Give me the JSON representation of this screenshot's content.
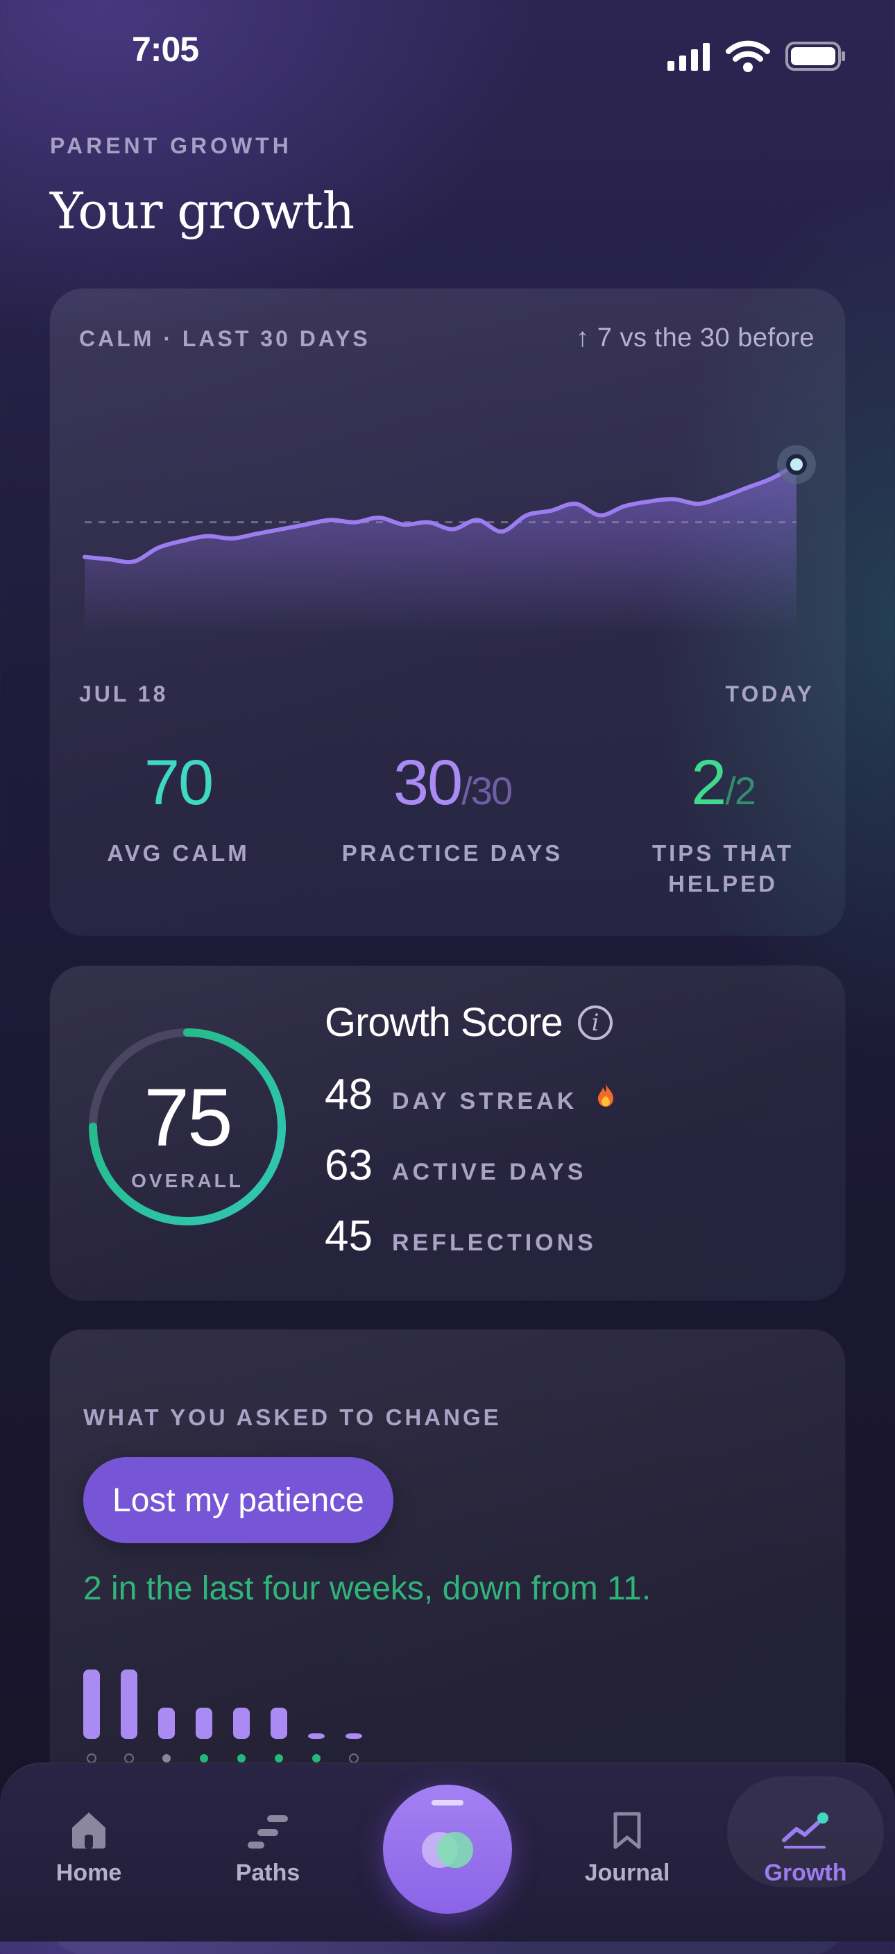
{
  "status_bar": {
    "time": "7:05"
  },
  "header": {
    "eyebrow": "PARENT GROWTH",
    "title": "Your growth"
  },
  "calm_card": {
    "label": "CALM · LAST 30 DAYS",
    "trend": "↑ 7 vs the 30 before",
    "start_label": "JUL 18",
    "end_label": "TODAY",
    "line_color": "#9b7df0",
    "stats": [
      {
        "value": "70",
        "denominator": "",
        "label": "AVG CALM",
        "color": "#3fd8c0"
      },
      {
        "value": "30",
        "denominator": "/30",
        "label": "PRACTICE DAYS",
        "color": "#a98bf3"
      },
      {
        "value": "2",
        "denominator": "/2",
        "label": "TIPS THAT HELPED",
        "color": "#3fd98f"
      }
    ]
  },
  "chart_data": {
    "type": "area",
    "title": "CALM · LAST 30 DAYS",
    "x": [
      "JUL 18",
      "",
      "",
      "",
      "",
      "",
      "",
      "",
      "",
      "",
      "",
      "",
      "",
      "",
      "",
      "",
      "",
      "",
      "",
      "",
      "",
      "",
      "",
      "",
      "",
      "",
      "",
      "",
      "",
      "TODAY"
    ],
    "values": [
      48,
      47,
      46,
      52,
      55,
      57,
      56,
      58,
      60,
      62,
      64,
      63,
      65,
      62,
      63,
      60,
      64,
      59,
      66,
      68,
      71,
      66,
      70,
      72,
      73,
      71,
      74,
      78,
      82,
      88
    ],
    "reference_value": 63,
    "xlabel": "",
    "ylabel": "",
    "grid": false
  },
  "growth_score": {
    "title": "Growth Score",
    "overall_value": "75",
    "overall_label": "OVERALL",
    "progress": 0.75,
    "rows": [
      {
        "value": "48",
        "label": "DAY STREAK",
        "icon": "flame-icon"
      },
      {
        "value": "63",
        "label": "ACTIVE DAYS"
      },
      {
        "value": "45",
        "label": "REFLECTIONS"
      }
    ]
  },
  "change_card": {
    "label": "WHAT YOU ASKED TO CHANGE",
    "pill": "Lost my patience",
    "summary": "2 in the last four weeks, down from 11.",
    "bars": [
      {
        "value": 1.0,
        "dot": "empty"
      },
      {
        "value": 1.0,
        "dot": "empty"
      },
      {
        "value": 0.45,
        "dot": "grey"
      },
      {
        "value": 0.45,
        "dot": "green"
      },
      {
        "value": 0.45,
        "dot": "green"
      },
      {
        "value": 0.45,
        "dot": "green"
      },
      {
        "value": 0.06,
        "dot": "green"
      },
      {
        "value": 0.06,
        "dot": "empty"
      }
    ]
  },
  "nav": {
    "items": [
      {
        "label": "Home",
        "icon": "home-icon"
      },
      {
        "label": "Paths",
        "icon": "paths-icon"
      },
      {
        "label": "",
        "icon": "breathe-icon"
      },
      {
        "label": "Journal",
        "icon": "bookmark-icon"
      },
      {
        "label": "Growth",
        "icon": "growth-chart-icon",
        "active": true
      }
    ]
  }
}
